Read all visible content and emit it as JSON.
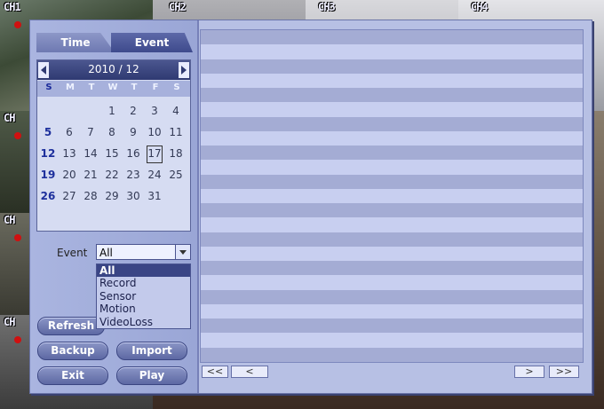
{
  "cameras": [
    {
      "label": "CH1"
    },
    {
      "label": "CH2"
    },
    {
      "label": "CH3"
    },
    {
      "label": "CH4"
    },
    {
      "label": "CH"
    },
    {
      "label": "CH"
    },
    {
      "label": "CH"
    }
  ],
  "tabs": {
    "time": "Time",
    "event": "Event"
  },
  "calendar": {
    "title": "2010 / 12",
    "dow": [
      "S",
      "M",
      "T",
      "W",
      "T",
      "F",
      "S"
    ],
    "days": [
      "1",
      "2",
      "3",
      "4",
      "5",
      "6",
      "7",
      "8",
      "9",
      "10",
      "11",
      "12",
      "13",
      "14",
      "15",
      "16",
      "17",
      "18",
      "19",
      "20",
      "21",
      "22",
      "23",
      "24",
      "25",
      "26",
      "27",
      "28",
      "29",
      "30",
      "31"
    ],
    "selected_day": "17"
  },
  "event_filter": {
    "label": "Event",
    "value": "All",
    "options": [
      "All",
      "Record",
      "Sensor",
      "Motion",
      "VideoLoss"
    ]
  },
  "buttons": {
    "refresh": "Refresh",
    "backup": "Backup",
    "import": "Import",
    "exit": "Exit",
    "play": "Play"
  },
  "pager": {
    "first": "<<",
    "prev": "<",
    "next": ">",
    "last": ">>"
  },
  "colors": {
    "panel": "#b7c0e4",
    "accent": "#3e4a8c",
    "row_dark": "#a4acd4",
    "row_light": "#c8cff0"
  }
}
